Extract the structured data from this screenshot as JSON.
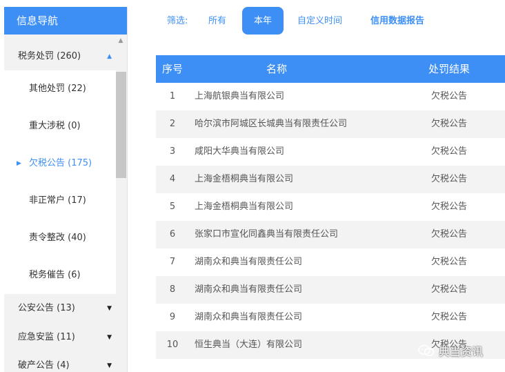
{
  "sidebar": {
    "title": "信息导航",
    "expanded_group": {
      "label": "税务处罚 (260)"
    },
    "subitems": [
      {
        "label": "其他处罚 (22)"
      },
      {
        "label": "重大涉税 (0)"
      },
      {
        "label": "欠税公告 (175)"
      },
      {
        "label": "非正常户 (17)"
      },
      {
        "label": "责令整改 (40)"
      },
      {
        "label": "税务催告 (6)"
      }
    ],
    "active_subitem": 2,
    "collapsed_groups": [
      {
        "label": "公安公告 (13)"
      },
      {
        "label": "应急安监 (11)"
      },
      {
        "label": "破产公告 (4)"
      }
    ]
  },
  "filter": {
    "label": "筛选:",
    "options": [
      {
        "label": "所有"
      },
      {
        "label": "本年"
      },
      {
        "label": "自定义时间"
      },
      {
        "label": "信用数据报告"
      }
    ],
    "active_index": 1
  },
  "table": {
    "headers": {
      "index": "序号",
      "name": "名称",
      "result": "处罚结果"
    },
    "rows": [
      {
        "index": "1",
        "name": "上海航银典当有限公司",
        "result": "欠税公告"
      },
      {
        "index": "2",
        "name": "哈尔滨市阿城区长城典当有限责任公司",
        "result": "欠税公告"
      },
      {
        "index": "3",
        "name": "咸阳大华典当有限公司",
        "result": "欠税公告"
      },
      {
        "index": "4",
        "name": "上海金梧桐典当有限公司",
        "result": "欠税公告"
      },
      {
        "index": "5",
        "name": "上海金梧桐典当有限公司",
        "result": "欠税公告"
      },
      {
        "index": "6",
        "name": "张家口市宣化同鑫典当有限责任公司",
        "result": "欠税公告"
      },
      {
        "index": "7",
        "name": "湖南众和典当有限责任公司",
        "result": "欠税公告"
      },
      {
        "index": "8",
        "name": "湖南众和典当有限责任公司",
        "result": "欠税公告"
      },
      {
        "index": "9",
        "name": "湖南众和典当有限责任公司",
        "result": "欠税公告"
      },
      {
        "index": "10",
        "name": "恒生典当（大连）有限公司",
        "result": "欠税公告"
      }
    ]
  },
  "watermark": {
    "text": "典当资讯",
    "icon": "wechat-icon"
  },
  "colors": {
    "accent": "#3d8ff5",
    "row_alt": "#f3f3f3",
    "sidebar_bg": "#f2f2f2"
  }
}
